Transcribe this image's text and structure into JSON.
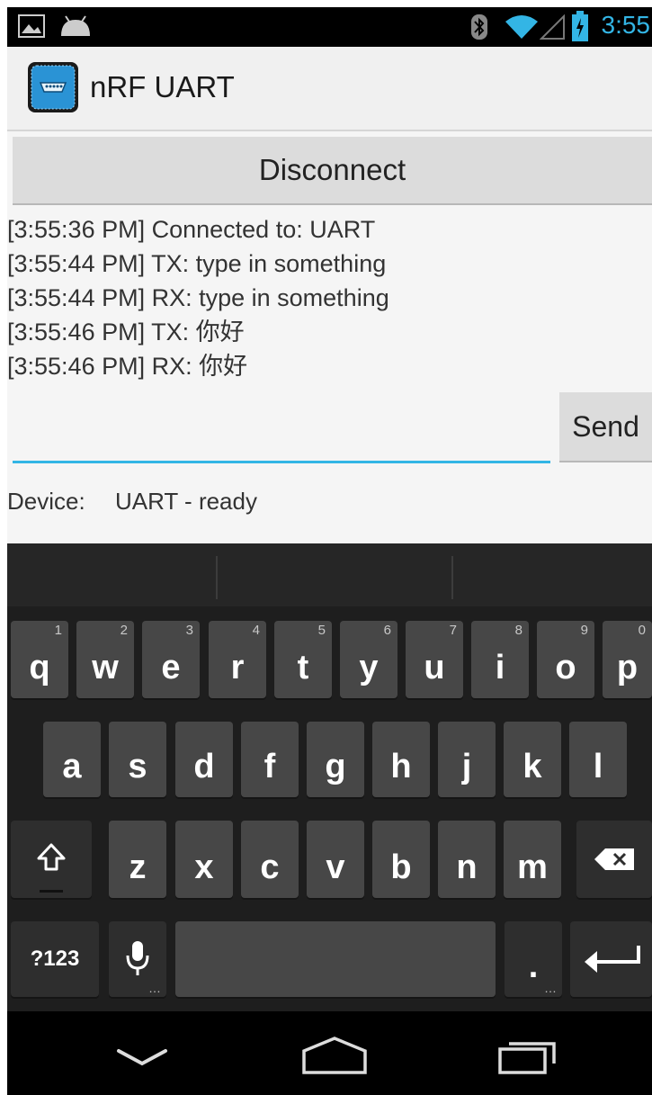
{
  "status_bar": {
    "time": "3:55"
  },
  "app": {
    "title": "nRF UART"
  },
  "main": {
    "disconnect_label": "Disconnect",
    "log": [
      "[3:55:36 PM] Connected to: UART",
      "[3:55:44 PM] TX: type in something",
      "[3:55:44 PM] RX: type in something",
      "[3:55:46 PM] TX: 你好",
      "[3:55:46 PM] RX: 你好"
    ],
    "input_value": "",
    "send_label": "Send",
    "device_label": "Device:",
    "device_status": "UART - ready"
  },
  "keyboard": {
    "row1": [
      "q",
      "w",
      "e",
      "r",
      "t",
      "y",
      "u",
      "i",
      "o",
      "p"
    ],
    "row1_hints": [
      "1",
      "2",
      "3",
      "4",
      "5",
      "6",
      "7",
      "8",
      "9",
      "0"
    ],
    "row2": [
      "a",
      "s",
      "d",
      "f",
      "g",
      "h",
      "j",
      "k",
      "l"
    ],
    "row3": [
      "z",
      "x",
      "c",
      "v",
      "b",
      "n",
      "m"
    ],
    "symbols_label": "?123",
    "period_label": "."
  },
  "icons": [
    "picture-icon",
    "android-icon",
    "bluetooth-icon",
    "wifi-icon",
    "signal-icon",
    "battery-icon",
    "app-icon",
    "shift-icon",
    "backspace-icon",
    "mic-icon",
    "enter-icon",
    "back-icon",
    "home-icon",
    "recents-icon"
  ],
  "colors": {
    "accent": "#33b5e5",
    "keyboard_bg": "#1e1e1e",
    "key": "#474747"
  }
}
